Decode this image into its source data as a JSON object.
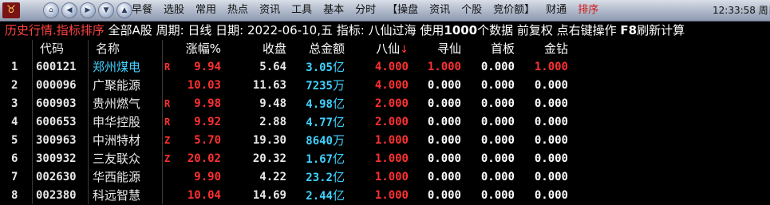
{
  "toolbar": {
    "logo_icon": "bull-logo-icon",
    "nav_icons": [
      "home-icon",
      "back-icon",
      "forward-icon",
      "down-icon",
      "up-icon"
    ],
    "menu": [
      "早餐",
      "选股",
      "常用",
      "热点",
      "资讯",
      "工具",
      "基本",
      "分时",
      "【操盘",
      "资讯",
      "个股",
      "竞价额】",
      "财通",
      "排序"
    ],
    "active_menu": "排序",
    "clock": "12:33:58 周日"
  },
  "info": {
    "title": "历史行情.指标排序",
    "rest_a": " 全部A股 周期: 日线 日期: ",
    "date": "2022-06-10",
    "rest_b": ",五 指标: 八仙过海  使用",
    "count": "1000",
    "rest_c": "个数据 前复权 点右键操作 ",
    "f8": "F8",
    "rest_d": "刷新计算"
  },
  "table": {
    "headers": {
      "code": "代码",
      "name": "名称",
      "change": "涨幅%",
      "price": "收盘",
      "amount": "总金额",
      "baxian": "八仙",
      "sort_icon": "↓",
      "xunxian": "寻仙",
      "shouban": "首板",
      "jinzuan": "金钻"
    },
    "rows": [
      {
        "idx": "1",
        "code": "600121",
        "name": "郑州煤电",
        "name_color": "#3fd2ff",
        "flag": "R",
        "change": "9.94",
        "price": "5.64",
        "amount": "3.05",
        "unit": "亿",
        "baxian": "4.000",
        "xunxian": "1.000",
        "shouban": "0.000",
        "jinzuan": "1.000",
        "xunxian_color": "#ff3030",
        "jinzuan_color": "#ff3030"
      },
      {
        "idx": "2",
        "code": "000096",
        "name": "广聚能源",
        "name_color": "#e8e8e8",
        "flag": "",
        "change": "10.03",
        "price": "11.63",
        "amount": "7235",
        "unit": "万",
        "baxian": "4.000",
        "xunxian": "0.000",
        "shouban": "0.000",
        "jinzuan": "0.000",
        "xunxian_color": "#ffffff",
        "jinzuan_color": "#ffffff"
      },
      {
        "idx": "3",
        "code": "600903",
        "name": "贵州燃气",
        "name_color": "#e8e8e8",
        "flag": "R",
        "change": "9.98",
        "price": "9.48",
        "amount": "4.98",
        "unit": "亿",
        "baxian": "2.000",
        "xunxian": "0.000",
        "shouban": "0.000",
        "jinzuan": "0.000",
        "xunxian_color": "#ffffff",
        "jinzuan_color": "#ffffff"
      },
      {
        "idx": "4",
        "code": "600653",
        "name": "申华控股",
        "name_color": "#e8e8e8",
        "flag": "R",
        "change": "9.92",
        "price": "2.88",
        "amount": "4.77",
        "unit": "亿",
        "baxian": "2.000",
        "xunxian": "0.000",
        "shouban": "0.000",
        "jinzuan": "0.000",
        "xunxian_color": "#ffffff",
        "jinzuan_color": "#ffffff"
      },
      {
        "idx": "5",
        "code": "300963",
        "name": "中洲特材",
        "name_color": "#e8e8e8",
        "flag": "Z",
        "change": "5.70",
        "price": "19.30",
        "amount": "8640",
        "unit": "万",
        "baxian": "1.000",
        "xunxian": "0.000",
        "shouban": "0.000",
        "jinzuan": "0.000",
        "xunxian_color": "#ffffff",
        "jinzuan_color": "#ffffff"
      },
      {
        "idx": "6",
        "code": "300932",
        "name": "三友联众",
        "name_color": "#e8e8e8",
        "flag": "Z",
        "change": "20.02",
        "price": "20.32",
        "amount": "1.67",
        "unit": "亿",
        "baxian": "1.000",
        "xunxian": "0.000",
        "shouban": "0.000",
        "jinzuan": "0.000",
        "xunxian_color": "#ffffff",
        "jinzuan_color": "#ffffff"
      },
      {
        "idx": "7",
        "code": "002630",
        "name": "华西能源",
        "name_color": "#e8e8e8",
        "flag": "",
        "change": "9.90",
        "price": "4.22",
        "amount": "23.2",
        "unit": "亿",
        "baxian": "1.000",
        "xunxian": "0.000",
        "shouban": "0.000",
        "jinzuan": "0.000",
        "xunxian_color": "#ffffff",
        "jinzuan_color": "#ffffff"
      },
      {
        "idx": "8",
        "code": "002380",
        "name": "科远智慧",
        "name_color": "#e8e8e8",
        "flag": "",
        "change": "10.04",
        "price": "14.69",
        "amount": "2.44",
        "unit": "亿",
        "baxian": "1.000",
        "xunxian": "0.000",
        "shouban": "0.000",
        "jinzuan": "0.000",
        "xunxian_color": "#ffffff",
        "jinzuan_color": "#ffffff"
      }
    ]
  },
  "colors": {
    "background": "#000000",
    "up_red": "#ff3030",
    "amount_cyan": "#3fd2ff",
    "title_red": "#ff4242"
  }
}
